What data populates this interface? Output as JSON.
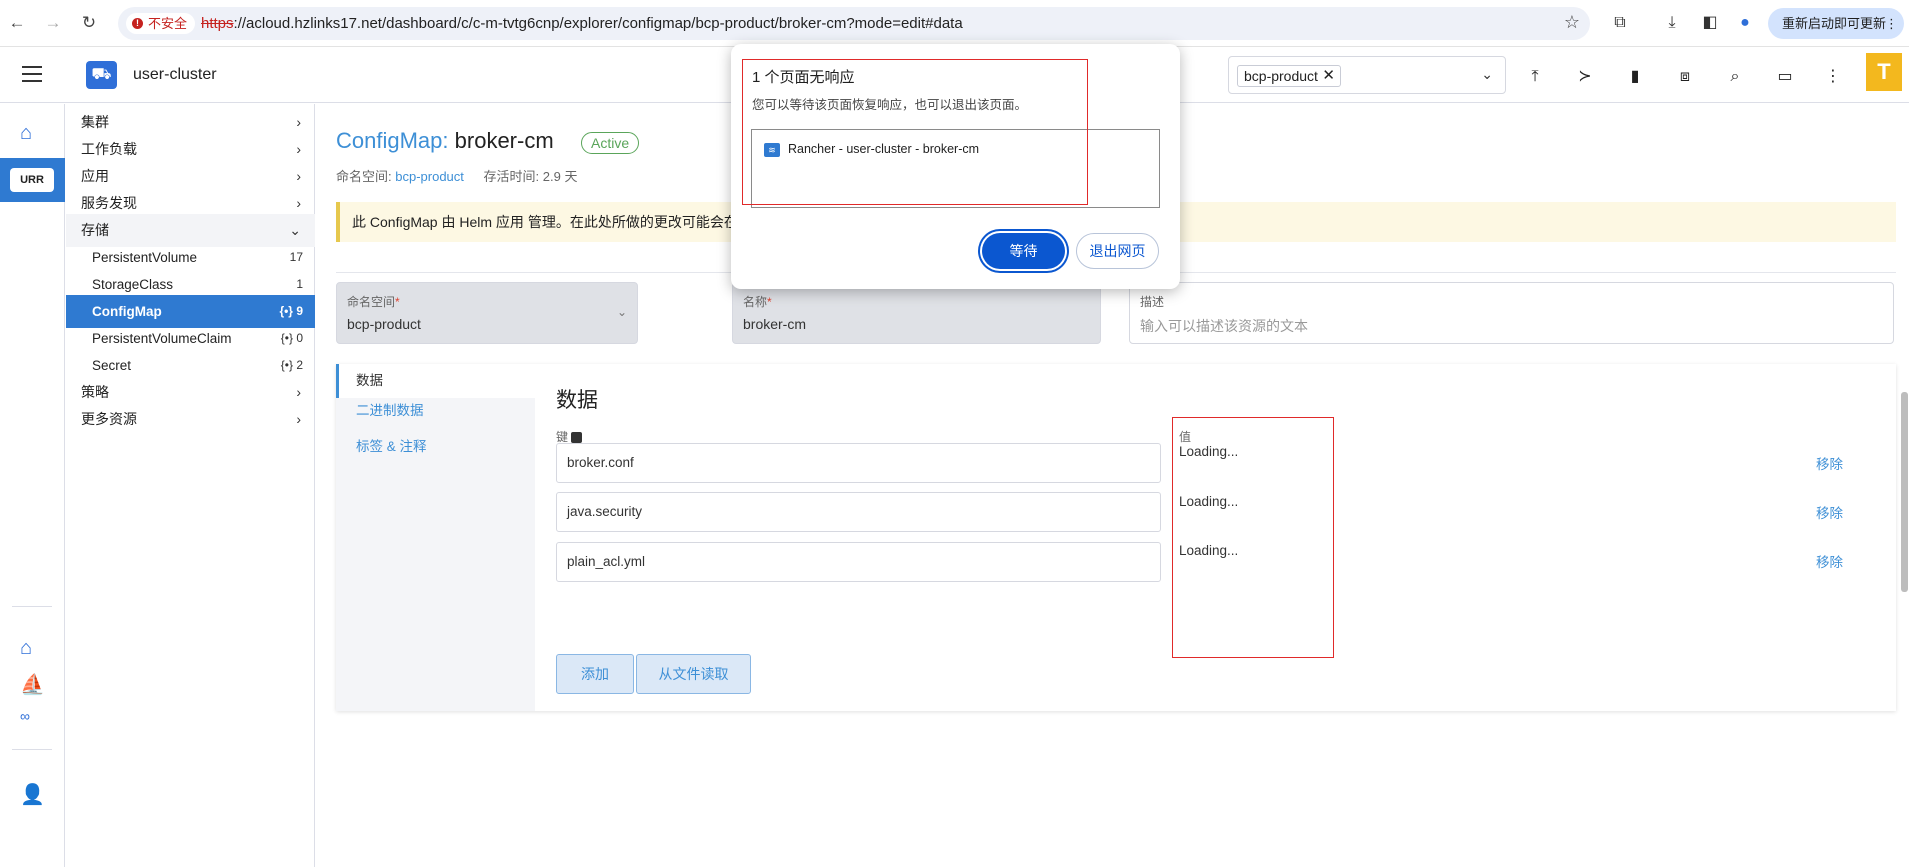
{
  "browser": {
    "insecure_label": "不安全",
    "url_scheme": "https",
    "url_rest": "://acloud.hzlinks17.net/dashboard/c/c-m-tvtg6cnp/explorer/configmap/bcp-product/broker-cm?mode=edit#data",
    "restart_label": "重新启动即可更新"
  },
  "header": {
    "cluster_name": "user-cluster",
    "namespace_chip": "bcp-product"
  },
  "rail": {
    "active_tag": "URR"
  },
  "sidenav": {
    "items": [
      {
        "label": "集群"
      },
      {
        "label": "工作负载"
      },
      {
        "label": "应用"
      },
      {
        "label": "服务发现"
      },
      {
        "label": "存储"
      },
      {
        "label": "PersistentVolume",
        "count": "17"
      },
      {
        "label": "StorageClass",
        "count": "1"
      },
      {
        "label": "ConfigMap",
        "count": "{•} 9"
      },
      {
        "label": "PersistentVolumeClaim",
        "count": "{•} 0"
      },
      {
        "label": "Secret",
        "count": "{•} 2"
      },
      {
        "label": "策略"
      },
      {
        "label": "更多资源"
      }
    ]
  },
  "page": {
    "kind": "ConfigMap:",
    "name": "broker-cm",
    "status": "Active",
    "namespace_label": "命名空间:",
    "namespace_value": "bcp-product",
    "age_label": "存活时间: 2.9 天",
    "banner": "此 ConfigMap 由 Helm 应用 管理。在此处所做的更改可能会在"
  },
  "form": {
    "namespace_label": "命名空间",
    "namespace_value": "bcp-product",
    "name_label": "名称",
    "name_value": "broker-cm",
    "desc_label": "描述",
    "desc_placeholder": "输入可以描述该资源的文本",
    "required_mark": "*"
  },
  "tabs": [
    {
      "label": "数据"
    },
    {
      "label": "二进制数据"
    },
    {
      "label": "标签 & 注释"
    }
  ],
  "data_section": {
    "title": "数据",
    "key_header": "键",
    "value_header": "值",
    "rows": [
      {
        "key": "broker.conf",
        "value": "Loading...",
        "remove": "移除"
      },
      {
        "key": "java.security",
        "value": "Loading...",
        "remove": "移除"
      },
      {
        "key": "plain_acl.yml",
        "value": "Loading...",
        "remove": "移除"
      }
    ],
    "add_label": "添加",
    "read_file_label": "从文件读取"
  },
  "dialog": {
    "title": "1 个页面无响应",
    "text": "您可以等待该页面恢复响应，也可以退出该页面。",
    "page_entry": "Rancher - user-cluster - broker-cm",
    "wait_label": "等待",
    "exit_label": "退出网页"
  }
}
